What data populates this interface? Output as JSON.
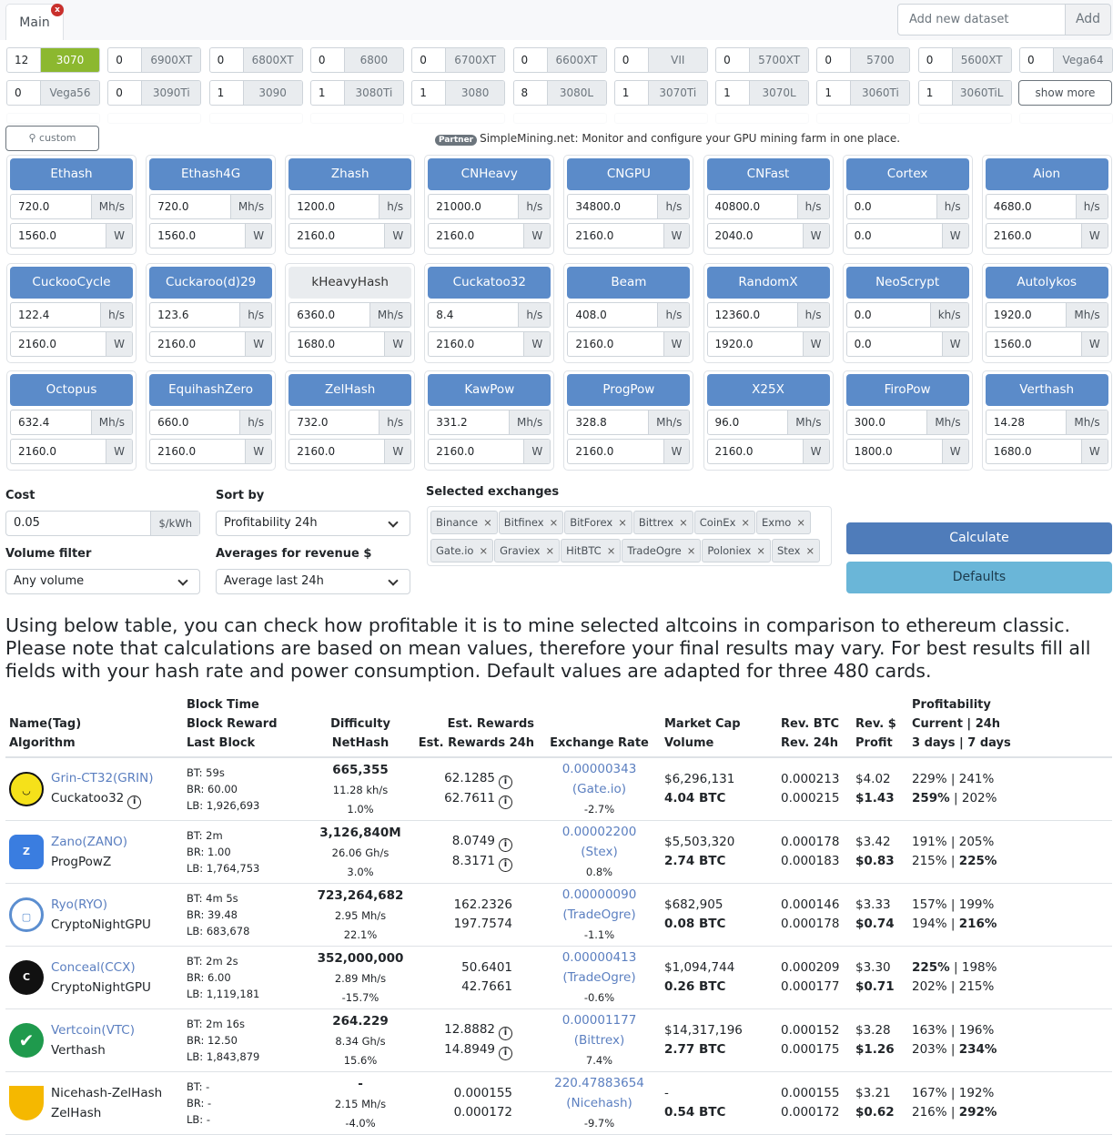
{
  "tabs": [
    {
      "label": "Main"
    }
  ],
  "tab_close": "x",
  "dataset": {
    "placeholder": "Add new dataset",
    "add_label": "Add"
  },
  "gpus": [
    {
      "count": "12",
      "name": "3070",
      "active": true
    },
    {
      "count": "0",
      "name": "6900XT"
    },
    {
      "count": "0",
      "name": "6800XT"
    },
    {
      "count": "0",
      "name": "6800"
    },
    {
      "count": "0",
      "name": "6700XT"
    },
    {
      "count": "0",
      "name": "6600XT"
    },
    {
      "count": "0",
      "name": "VII"
    },
    {
      "count": "0",
      "name": "5700XT"
    },
    {
      "count": "0",
      "name": "5700"
    },
    {
      "count": "0",
      "name": "5600XT"
    },
    {
      "count": "0",
      "name": "Vega64"
    },
    {
      "count": "0",
      "name": "Vega56"
    },
    {
      "count": "0",
      "name": "3090Ti"
    },
    {
      "count": "1",
      "name": "3090"
    },
    {
      "count": "1",
      "name": "3080Ti"
    },
    {
      "count": "1",
      "name": "3080"
    },
    {
      "count": "8",
      "name": "3080L"
    },
    {
      "count": "1",
      "name": "3070Ti"
    },
    {
      "count": "1",
      "name": "3070L"
    },
    {
      "count": "1",
      "name": "3060Ti"
    },
    {
      "count": "1",
      "name": "3060TiL"
    }
  ],
  "show_more": "show more",
  "custom_label": "custom",
  "partner": {
    "badge": "Partner",
    "text": "SimpleMining.net: Monitor and configure your GPU mining farm in one place."
  },
  "algorithms": [
    {
      "name": "Ethash",
      "hash": "720.0",
      "unit": "Mh/s",
      "power": "1560.0",
      "w": "W",
      "on": true
    },
    {
      "name": "Ethash4G",
      "hash": "720.0",
      "unit": "Mh/s",
      "power": "1560.0",
      "w": "W",
      "on": true
    },
    {
      "name": "Zhash",
      "hash": "1200.0",
      "unit": "h/s",
      "power": "2160.0",
      "w": "W",
      "on": true
    },
    {
      "name": "CNHeavy",
      "hash": "21000.0",
      "unit": "h/s",
      "power": "2160.0",
      "w": "W",
      "on": true
    },
    {
      "name": "CNGPU",
      "hash": "34800.0",
      "unit": "h/s",
      "power": "2160.0",
      "w": "W",
      "on": true
    },
    {
      "name": "CNFast",
      "hash": "40800.0",
      "unit": "h/s",
      "power": "2040.0",
      "w": "W",
      "on": true
    },
    {
      "name": "Cortex",
      "hash": "0.0",
      "unit": "h/s",
      "power": "0.0",
      "w": "W",
      "on": true
    },
    {
      "name": "Aion",
      "hash": "4680.0",
      "unit": "h/s",
      "power": "2160.0",
      "w": "W",
      "on": true
    },
    {
      "name": "CuckooCycle",
      "hash": "122.4",
      "unit": "h/s",
      "power": "2160.0",
      "w": "W",
      "on": true
    },
    {
      "name": "Cuckaroo(d)29",
      "hash": "123.6",
      "unit": "h/s",
      "power": "2160.0",
      "w": "W",
      "on": true
    },
    {
      "name": "kHeavyHash",
      "hash": "6360.0",
      "unit": "Mh/s",
      "power": "1680.0",
      "w": "W",
      "on": false
    },
    {
      "name": "Cuckatoo32",
      "hash": "8.4",
      "unit": "h/s",
      "power": "2160.0",
      "w": "W",
      "on": true
    },
    {
      "name": "Beam",
      "hash": "408.0",
      "unit": "h/s",
      "power": "2160.0",
      "w": "W",
      "on": true
    },
    {
      "name": "RandomX",
      "hash": "12360.0",
      "unit": "h/s",
      "power": "1920.0",
      "w": "W",
      "on": true
    },
    {
      "name": "NeoScrypt",
      "hash": "0.0",
      "unit": "kh/s",
      "power": "0.0",
      "w": "W",
      "on": true
    },
    {
      "name": "Autolykos",
      "hash": "1920.0",
      "unit": "Mh/s",
      "power": "1560.0",
      "w": "W",
      "on": true
    },
    {
      "name": "Octopus",
      "hash": "632.4",
      "unit": "Mh/s",
      "power": "2160.0",
      "w": "W",
      "on": true
    },
    {
      "name": "EquihashZero",
      "hash": "660.0",
      "unit": "h/s",
      "power": "2160.0",
      "w": "W",
      "on": true
    },
    {
      "name": "ZelHash",
      "hash": "732.0",
      "unit": "h/s",
      "power": "2160.0",
      "w": "W",
      "on": true
    },
    {
      "name": "KawPow",
      "hash": "331.2",
      "unit": "Mh/s",
      "power": "2160.0",
      "w": "W",
      "on": true
    },
    {
      "name": "ProgPow",
      "hash": "328.8",
      "unit": "Mh/s",
      "power": "2160.0",
      "w": "W",
      "on": true
    },
    {
      "name": "X25X",
      "hash": "96.0",
      "unit": "Mh/s",
      "power": "2160.0",
      "w": "W",
      "on": true
    },
    {
      "name": "FiroPow",
      "hash": "300.0",
      "unit": "Mh/s",
      "power": "1800.0",
      "w": "W",
      "on": true
    },
    {
      "name": "Verthash",
      "hash": "14.28",
      "unit": "Mh/s",
      "power": "1680.0",
      "w": "W",
      "on": true
    }
  ],
  "controls": {
    "cost_label": "Cost",
    "cost_value": "0.05",
    "cost_unit": "$/kWh",
    "sort_label": "Sort by",
    "sort_value": "Profitability 24h",
    "volume_label": "Volume filter",
    "volume_value": "Any volume",
    "avg_label": "Averages for revenue $",
    "avg_value": "Average last 24h",
    "exchanges_label": "Selected exchanges",
    "exchanges": [
      "Binance",
      "Bitfinex",
      "BitForex",
      "Bittrex",
      "CoinEx",
      "Exmo",
      "Gate.io",
      "Graviex",
      "HitBTC",
      "TradeOgre",
      "Poloniex",
      "Stex"
    ],
    "chip_x": "×",
    "calculate": "Calculate",
    "defaults": "Defaults"
  },
  "intro": "Using below table, you can check how profitable it is to mine selected altcoins in comparison to ethereum classic. Please note that calculations are based on mean values, therefore your final results may vary. For best results fill all fields with your hash rate and power consumption. Default values are adapted for three 480 cards.",
  "table": {
    "headers": {
      "name": [
        "Name(Tag)",
        "Algorithm"
      ],
      "block": [
        "Block Time",
        "Block Reward",
        "Last Block"
      ],
      "difficulty": [
        "Difficulty",
        "NetHash"
      ],
      "rewards": [
        "Est. Rewards",
        "Est. Rewards 24h"
      ],
      "exchange": [
        "Exchange Rate"
      ],
      "market": [
        "Market Cap",
        "Volume"
      ],
      "revbtc": [
        "Rev. BTC",
        "Rev. 24h"
      ],
      "revusd": [
        "Rev. $",
        "Profit"
      ],
      "profit": [
        "Profitability",
        "Current | 24h",
        "3 days | 7 days"
      ]
    },
    "rows": [
      {
        "icon": "grin-logo",
        "name": "Grin-CT32(GRIN)",
        "algo": "Cuckatoo32",
        "algo_info": true,
        "bt": "BT: 59s",
        "br": "BR: 60.00",
        "lb": "LB: 1,926,693",
        "diff": "665,355",
        "nethash": "11.28 kh/s",
        "diff_change": "1.0%",
        "rew": "62.1285",
        "rew24": "62.7611",
        "rew_info": true,
        "rate": "0.00000343",
        "exch": "(Gate.io)",
        "rate_change": "-2.7%",
        "mcap": "$6,296,131",
        "vol": "4.04 BTC",
        "revbtc": "0.000213",
        "rev24": "0.000215",
        "revusd": "$4.02",
        "profit": "$1.43",
        "p_cur": "229%",
        "p_24": "241%",
        "p_3d": "259%",
        "p_7d": "202%",
        "bold": "p_3d",
        "color": "#f5e11a"
      },
      {
        "icon": "zano-logo",
        "name": "Zano(ZANO)",
        "algo": "ProgPowZ",
        "algo_info": false,
        "bt": "BT: 2m",
        "br": "BR: 1.00",
        "lb": "LB: 1,764,753",
        "diff": "3,126,840M",
        "nethash": "26.06 Gh/s",
        "diff_change": "3.0%",
        "rew": "8.0749",
        "rew24": "8.3171",
        "rew_info": true,
        "rate": "0.00002200",
        "exch": "(Stex)",
        "rate_change": "0.8%",
        "mcap": "$5,503,320",
        "vol": "2.74 BTC",
        "revbtc": "0.000178",
        "rev24": "0.000183",
        "revusd": "$3.42",
        "profit": "$0.83",
        "p_cur": "191%",
        "p_24": "205%",
        "p_3d": "215%",
        "p_7d": "225%",
        "bold": "p_7d",
        "color": "#3a7de0"
      },
      {
        "icon": "ryo-logo",
        "name": "Ryo(RYO)",
        "algo": "CryptoNightGPU",
        "algo_info": false,
        "bt": "BT: 4m 5s",
        "br": "BR: 39.48",
        "lb": "LB: 683,678",
        "diff": "723,264,682",
        "nethash": "2.95 Mh/s",
        "diff_change": "22.1%",
        "rew": "162.2326",
        "rew24": "197.7574",
        "rew_info": false,
        "rate": "0.00000090",
        "exch": "(TradeOgre)",
        "rate_change": "-1.1%",
        "mcap": "$682,905",
        "vol": "0.08 BTC",
        "revbtc": "0.000146",
        "rev24": "0.000178",
        "revusd": "$3.33",
        "profit": "$0.74",
        "p_cur": "157%",
        "p_24": "199%",
        "p_3d": "194%",
        "p_7d": "216%",
        "bold": "p_7d",
        "color": "#5b8ed0"
      },
      {
        "icon": "conceal-logo",
        "name": "Conceal(CCX)",
        "algo": "CryptoNightGPU",
        "algo_info": false,
        "bt": "BT: 2m 2s",
        "br": "BR: 6.00",
        "lb": "LB: 1,119,181",
        "diff": "352,000,000",
        "nethash": "2.89 Mh/s",
        "diff_change": "-15.7%",
        "rew": "50.6401",
        "rew24": "42.7661",
        "rew_info": false,
        "rate": "0.00000413",
        "exch": "(TradeOgre)",
        "rate_change": "-0.6%",
        "mcap": "$1,094,744",
        "vol": "0.26 BTC",
        "revbtc": "0.000209",
        "rev24": "0.000177",
        "revusd": "$3.30",
        "profit": "$0.71",
        "p_cur": "225%",
        "p_24": "198%",
        "p_3d": "202%",
        "p_7d": "215%",
        "bold": "p_cur",
        "color": "#111"
      },
      {
        "icon": "vertcoin-logo",
        "name": "Vertcoin(VTC)",
        "algo": "Verthash",
        "algo_info": false,
        "bt": "BT: 2m 16s",
        "br": "BR: 12.50",
        "lb": "LB: 1,843,879",
        "diff": "264.229",
        "nethash": "8.34 Gh/s",
        "diff_change": "15.6%",
        "rew": "12.8882",
        "rew24": "14.8949",
        "rew_info": true,
        "rate": "0.00001177",
        "exch": "(Bittrex)",
        "rate_change": "7.4%",
        "mcap": "$14,317,196",
        "vol": "2.77 BTC",
        "revbtc": "0.000152",
        "rev24": "0.000175",
        "revusd": "$3.28",
        "profit": "$1.26",
        "p_cur": "163%",
        "p_24": "196%",
        "p_3d": "203%",
        "p_7d": "234%",
        "bold": "p_7d",
        "color": "#1f9a4d"
      },
      {
        "icon": "nicehash-logo",
        "name": "Nicehash-ZelHash",
        "algo": "ZelHash",
        "algo_info": false,
        "bt": "BT: -",
        "br": "BR: -",
        "lb": "LB: -",
        "diff": "-",
        "nethash": "2.15 Mh/s",
        "diff_change": "-4.0%",
        "rew": "0.000155",
        "rew24": "0.000172",
        "rew_info": false,
        "rate": "220.47883654",
        "exch": "(Nicehash)",
        "rate_change": "-9.7%",
        "mcap": "-",
        "vol": "0.54 BTC",
        "revbtc": "0.000155",
        "rev24": "0.000172",
        "revusd": "$3.21",
        "profit": "$0.62",
        "p_cur": "167%",
        "p_24": "192%",
        "p_3d": "216%",
        "p_7d": "292%",
        "bold": "p_7d",
        "color": "#f5b800"
      }
    ]
  }
}
